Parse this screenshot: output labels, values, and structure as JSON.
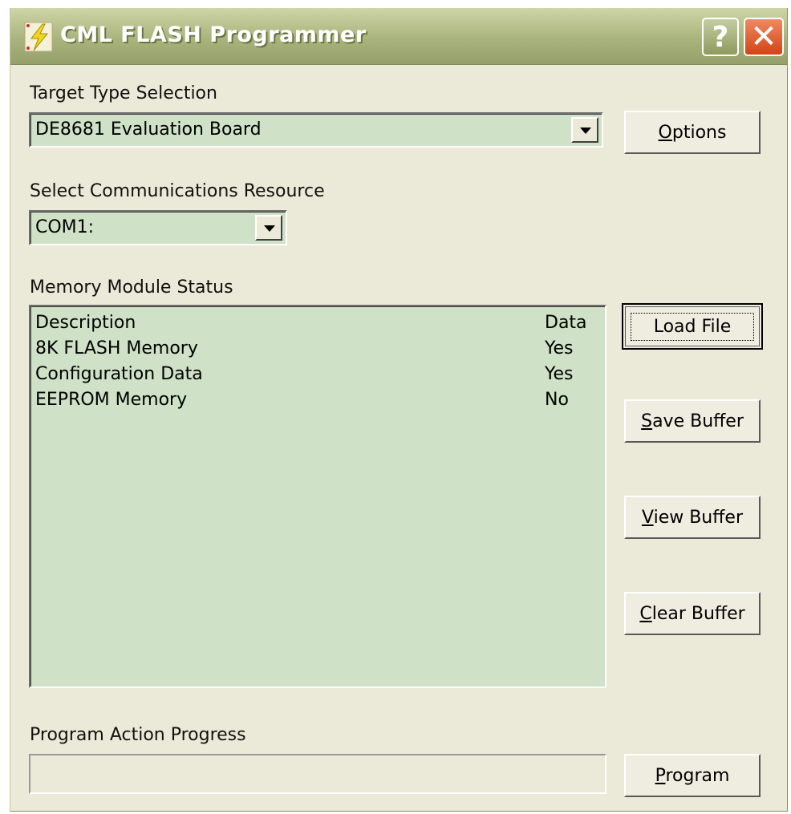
{
  "window": {
    "title": "CML FLASH Programmer",
    "help_label": "?",
    "close_label": "✕"
  },
  "target": {
    "label": "Target Type Selection",
    "selected": "DE8681 Evaluation Board",
    "options_button": "Options"
  },
  "comm": {
    "label": "Select Communications Resource",
    "selected": "COM1:"
  },
  "memory": {
    "label": "Memory Module Status",
    "rows": [
      {
        "description": "Description",
        "data": "Data"
      },
      {
        "description": "8K FLASH Memory",
        "data": "Yes"
      },
      {
        "description": "Configuration Data",
        "data": "Yes"
      },
      {
        "description": "EEPROM Memory",
        "data": "No"
      }
    ]
  },
  "buttons": {
    "load_file": "Load File",
    "save_buffer": "Save Buffer",
    "view_buffer": "View Buffer",
    "clear_buffer": "Clear Buffer",
    "program": "Program"
  },
  "progress": {
    "label": "Program Action Progress",
    "value": 0
  },
  "colors": {
    "field_bg": "#cfe1c6",
    "window_bg": "#ebe9d7",
    "titlebar": "#a9b47c",
    "close": "#d24316"
  },
  "icons": {
    "app": "lightning-bolt-icon",
    "help": "help-icon",
    "close": "close-icon",
    "dropdown": "chevron-down-icon"
  }
}
